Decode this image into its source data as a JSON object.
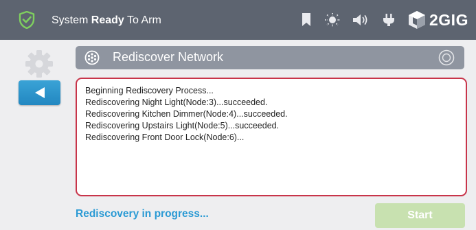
{
  "status_bar": {
    "status_prefix": "System ",
    "status_bold": "Ready",
    "status_suffix": " To Arm",
    "brand": "2GIG",
    "icons": [
      "shield-check-icon",
      "bookmark-icon",
      "brightness-icon",
      "volume-icon",
      "power-plug-icon",
      "2gig-cube-logo"
    ]
  },
  "sidebar": {
    "icons": [
      "gear-icon",
      "back-arrow-icon"
    ]
  },
  "header": {
    "title": "Rediscover Network",
    "icons": [
      "network-icon",
      "ring-icon"
    ]
  },
  "log": {
    "lines": [
      "Beginning Rediscovery Process...",
      "Rediscovering Night Light(Node:3)...succeeded.",
      "Rediscovering Kitchen Dimmer(Node:4)...succeeded.",
      "Rediscovering Upstairs Light(Node:5)...succeeded.",
      "Rediscovering Front Door Lock(Node:6)..."
    ]
  },
  "footer": {
    "progress_text": "Rediscovery in progress...",
    "start_label": "Start"
  },
  "colors": {
    "status_bar_bg": "#5d6470",
    "accent_blue": "#2a9ad4",
    "log_border_red": "#c8344a",
    "start_button_disabled_green": "#c8e1b0",
    "shield_green": "#7fcf5f"
  }
}
